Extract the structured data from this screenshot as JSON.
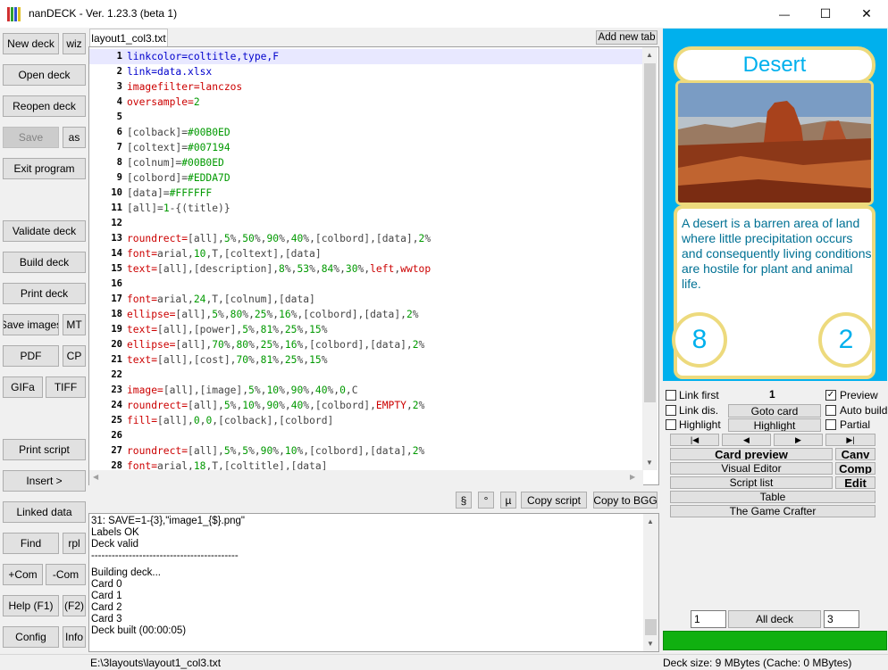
{
  "window": {
    "title": "nanDECK - Ver. 1.23.3 (beta 1)",
    "minimize": "—",
    "maximize": "☐",
    "close": "✕"
  },
  "colors": {
    "back": "#00B0ED",
    "text": "#007194",
    "num": "#00B0ED",
    "bord": "#EDDA7D",
    "progress": "#10b010"
  },
  "left_buttons": {
    "new_deck": "New deck",
    "wiz": "wiz",
    "open_deck": "Open deck",
    "reopen_deck": "Reopen deck",
    "save": "Save",
    "as": "as",
    "exit": "Exit program",
    "validate": "Validate deck",
    "build": "Build deck",
    "print_deck": "Print deck",
    "save_images": "Save images",
    "mt": "MT",
    "pdf": "PDF",
    "cp": "CP",
    "gifa": "GIFa",
    "tiff": "TIFF",
    "print_script": "Print script",
    "insert": "Insert >",
    "linked_data": "Linked data",
    "find": "Find",
    "rpl": "rpl",
    "com_add": "+Com",
    "com_remove": "-Com",
    "help": "Help (F1)",
    "f2": "(F2)",
    "config": "Config",
    "info": "Info"
  },
  "editor": {
    "tab_label": "layout1_col3.txt",
    "add_tab": "Add new tab",
    "lines": [
      {
        "n": "1",
        "parts": [
          [
            "blue",
            "linkcolor="
          ],
          [
            "blue",
            "coltitle,type,F"
          ]
        ]
      },
      {
        "n": "2",
        "parts": [
          [
            "blue",
            "link="
          ],
          [
            "blue",
            "data.xlsx"
          ]
        ]
      },
      {
        "n": "3",
        "parts": [
          [
            "red",
            "imagefilter="
          ],
          [
            "red",
            "lanczos"
          ]
        ]
      },
      {
        "n": "4",
        "parts": [
          [
            "red",
            "oversample="
          ],
          [
            "num",
            "2"
          ]
        ]
      },
      {
        "n": "5",
        "parts": []
      },
      {
        "n": "6",
        "parts": [
          [
            "gray",
            "[colback]="
          ],
          [
            "num",
            "#00B0ED"
          ]
        ]
      },
      {
        "n": "7",
        "parts": [
          [
            "gray",
            "[coltext]="
          ],
          [
            "num",
            "#007194"
          ]
        ]
      },
      {
        "n": "8",
        "parts": [
          [
            "gray",
            "[colnum]="
          ],
          [
            "num",
            "#00B0ED"
          ]
        ]
      },
      {
        "n": "9",
        "parts": [
          [
            "gray",
            "[colbord]="
          ],
          [
            "num",
            "#EDDA7D"
          ]
        ]
      },
      {
        "n": "10",
        "parts": [
          [
            "gray",
            "[data]="
          ],
          [
            "num",
            "#FFFFFF"
          ]
        ]
      },
      {
        "n": "11",
        "parts": [
          [
            "gray",
            "[all]="
          ],
          [
            "num",
            "1"
          ],
          [
            "gray",
            "-{(title)}"
          ]
        ]
      },
      {
        "n": "12",
        "parts": []
      },
      {
        "n": "13",
        "parts": [
          [
            "red",
            "roundrect="
          ],
          [
            "gray",
            "[all],"
          ],
          [
            "num",
            "5"
          ],
          [
            "gray",
            "%,"
          ],
          [
            "num",
            "50"
          ],
          [
            "gray",
            "%,"
          ],
          [
            "num",
            "90"
          ],
          [
            "gray",
            "%,"
          ],
          [
            "num",
            "40"
          ],
          [
            "gray",
            "%,[colbord],[data],"
          ],
          [
            "num",
            "2"
          ],
          [
            "gray",
            "%"
          ]
        ]
      },
      {
        "n": "14",
        "parts": [
          [
            "red",
            "font="
          ],
          [
            "gray",
            "arial,"
          ],
          [
            "num",
            "10"
          ],
          [
            "gray",
            ",T,[coltext],[data]"
          ]
        ]
      },
      {
        "n": "15",
        "parts": [
          [
            "red",
            "text="
          ],
          [
            "gray",
            "[all],[description],"
          ],
          [
            "num",
            "8"
          ],
          [
            "gray",
            "%,"
          ],
          [
            "num",
            "53"
          ],
          [
            "gray",
            "%,"
          ],
          [
            "num",
            "84"
          ],
          [
            "gray",
            "%,"
          ],
          [
            "num",
            "30"
          ],
          [
            "gray",
            "%,"
          ],
          [
            "red",
            "left"
          ],
          [
            "gray",
            ","
          ],
          [
            "red",
            "wwtop"
          ]
        ]
      },
      {
        "n": "16",
        "parts": []
      },
      {
        "n": "17",
        "parts": [
          [
            "red",
            "font="
          ],
          [
            "gray",
            "arial,"
          ],
          [
            "num",
            "24"
          ],
          [
            "gray",
            ",T,[colnum],[data]"
          ]
        ]
      },
      {
        "n": "18",
        "parts": [
          [
            "red",
            "ellipse="
          ],
          [
            "gray",
            "[all],"
          ],
          [
            "num",
            "5"
          ],
          [
            "gray",
            "%,"
          ],
          [
            "num",
            "80"
          ],
          [
            "gray",
            "%,"
          ],
          [
            "num",
            "25"
          ],
          [
            "gray",
            "%,"
          ],
          [
            "num",
            "16"
          ],
          [
            "gray",
            "%,[colbord],[data],"
          ],
          [
            "num",
            "2"
          ],
          [
            "gray",
            "%"
          ]
        ]
      },
      {
        "n": "19",
        "parts": [
          [
            "red",
            "text="
          ],
          [
            "gray",
            "[all],[power],"
          ],
          [
            "num",
            "5"
          ],
          [
            "gray",
            "%,"
          ],
          [
            "num",
            "81"
          ],
          [
            "gray",
            "%,"
          ],
          [
            "num",
            "25"
          ],
          [
            "gray",
            "%,"
          ],
          [
            "num",
            "15"
          ],
          [
            "gray",
            "%"
          ]
        ]
      },
      {
        "n": "20",
        "parts": [
          [
            "red",
            "ellipse="
          ],
          [
            "gray",
            "[all],"
          ],
          [
            "num",
            "70"
          ],
          [
            "gray",
            "%,"
          ],
          [
            "num",
            "80"
          ],
          [
            "gray",
            "%,"
          ],
          [
            "num",
            "25"
          ],
          [
            "gray",
            "%,"
          ],
          [
            "num",
            "16"
          ],
          [
            "gray",
            "%,[colbord],[data],"
          ],
          [
            "num",
            "2"
          ],
          [
            "gray",
            "%"
          ]
        ]
      },
      {
        "n": "21",
        "parts": [
          [
            "red",
            "text="
          ],
          [
            "gray",
            "[all],[cost],"
          ],
          [
            "num",
            "70"
          ],
          [
            "gray",
            "%,"
          ],
          [
            "num",
            "81"
          ],
          [
            "gray",
            "%,"
          ],
          [
            "num",
            "25"
          ],
          [
            "gray",
            "%,"
          ],
          [
            "num",
            "15"
          ],
          [
            "gray",
            "%"
          ]
        ]
      },
      {
        "n": "22",
        "parts": []
      },
      {
        "n": "23",
        "parts": [
          [
            "red",
            "image="
          ],
          [
            "gray",
            "[all],[image],"
          ],
          [
            "num",
            "5"
          ],
          [
            "gray",
            "%,"
          ],
          [
            "num",
            "10"
          ],
          [
            "gray",
            "%,"
          ],
          [
            "num",
            "90"
          ],
          [
            "gray",
            "%,"
          ],
          [
            "num",
            "40"
          ],
          [
            "gray",
            "%,"
          ],
          [
            "num",
            "0"
          ],
          [
            "gray",
            ",C"
          ]
        ]
      },
      {
        "n": "24",
        "parts": [
          [
            "red",
            "roundrect="
          ],
          [
            "gray",
            "[all],"
          ],
          [
            "num",
            "5"
          ],
          [
            "gray",
            "%,"
          ],
          [
            "num",
            "10"
          ],
          [
            "gray",
            "%,"
          ],
          [
            "num",
            "90"
          ],
          [
            "gray",
            "%,"
          ],
          [
            "num",
            "40"
          ],
          [
            "gray",
            "%,[colbord],"
          ],
          [
            "red",
            "EMPTY"
          ],
          [
            "gray",
            ","
          ],
          [
            "num",
            "2"
          ],
          [
            "gray",
            "%"
          ]
        ]
      },
      {
        "n": "25",
        "parts": [
          [
            "red",
            "fill="
          ],
          [
            "gray",
            "[all],"
          ],
          [
            "num",
            "0"
          ],
          [
            "gray",
            ","
          ],
          [
            "num",
            "0"
          ],
          [
            "gray",
            ",[colback],[colbord]"
          ]
        ]
      },
      {
        "n": "26",
        "parts": []
      },
      {
        "n": "27",
        "parts": [
          [
            "red",
            "roundrect="
          ],
          [
            "gray",
            "[all],"
          ],
          [
            "num",
            "5"
          ],
          [
            "gray",
            "%,"
          ],
          [
            "num",
            "5"
          ],
          [
            "gray",
            "%,"
          ],
          [
            "num",
            "90"
          ],
          [
            "gray",
            "%,"
          ],
          [
            "num",
            "10"
          ],
          [
            "gray",
            "%,[colbord],[data],"
          ],
          [
            "num",
            "2"
          ],
          [
            "gray",
            "%"
          ]
        ]
      },
      {
        "n": "28",
        "parts": [
          [
            "red",
            "font="
          ],
          [
            "gray",
            "arial,"
          ],
          [
            "num",
            "18"
          ],
          [
            "gray",
            ",T,[coltitle],[data]"
          ]
        ]
      }
    ]
  },
  "editor_buttons": {
    "section": "§",
    "degree": "°",
    "mu": "µ",
    "copy_script": "Copy script",
    "copy_bgg": "Copy to BGG"
  },
  "output_lines": [
    "31: SAVE=1-{3},\"image1_{$}.png\"",
    "Labels OK",
    "Deck valid",
    "-------------------------------------------",
    "Building deck...",
    "Card 0",
    "Card 1",
    "Card 2",
    "Card 3",
    "Deck built (00:00:05)"
  ],
  "card": {
    "title": "Desert",
    "description": "A desert is a barren area of land where little precipitation occurs and consequently living conditions are hostile for plant and animal life.",
    "power": "8",
    "cost": "2"
  },
  "right_panel": {
    "link_first": "Link first",
    "card_number": "1",
    "preview": "Preview",
    "link_dis": "Link dis.",
    "goto_card": "Goto card",
    "auto_build": "Auto build",
    "highlight_chk": "Highlight",
    "highlight_btn": "Highlight",
    "partial": "Partial",
    "nav_first": "|◀",
    "nav_prev": "◀",
    "nav_next": "▶",
    "nav_last": "▶|",
    "card_preview": "Card preview",
    "canv": "Canv",
    "visual_editor": "Visual Editor",
    "comp": "Comp",
    "script_list": "Script list",
    "edit": "Edit",
    "table": "Table",
    "game_crafter": "The Game Crafter",
    "range_from": "1",
    "all_deck": "All deck",
    "range_to": "3"
  },
  "status": {
    "path": "E:\\3layouts\\layout1_col3.txt",
    "deck_size": "Deck size: 9 MBytes (Cache: 0 MBytes)"
  }
}
